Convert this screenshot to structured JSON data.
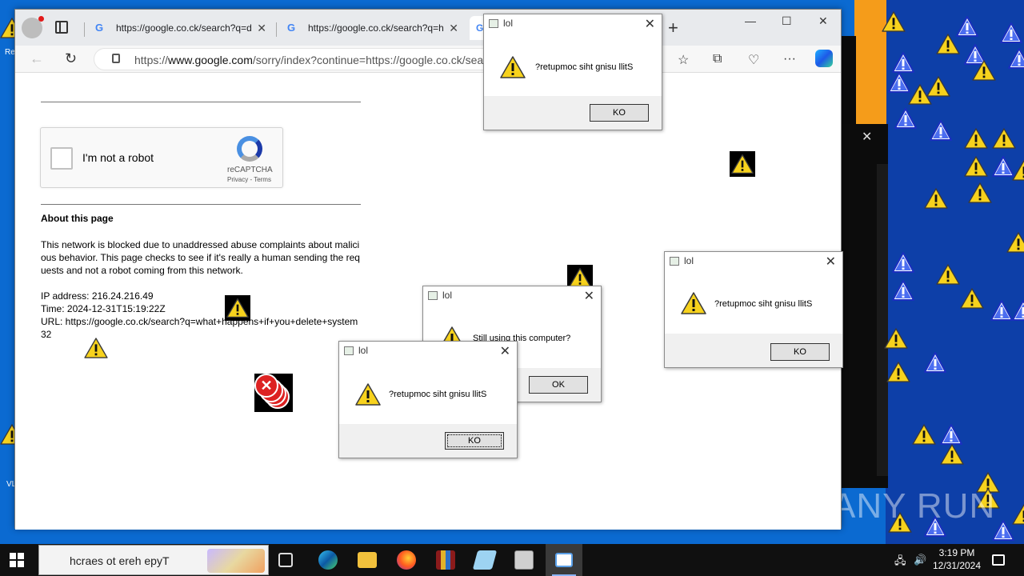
{
  "browser": {
    "tabs": [
      {
        "title": "https://google.co.ck/search?q=d"
      },
      {
        "title": "https://google.co.ck/search?q=h"
      },
      {
        "title": "G"
      }
    ],
    "new_tab": "+",
    "window_controls": {
      "minimize": "—",
      "maximize": "☐",
      "close": "✕"
    },
    "url_prefix": "https://",
    "url_host": "www.google.com",
    "url_path": "/sorry/index?continue=https://google.co.ck/sear"
  },
  "page": {
    "recaptcha": {
      "label": "I'm not a robot",
      "brand": "reCAPTCHA",
      "terms": "Privacy - Terms"
    },
    "about_title": "About this page",
    "about_text": "This network is blocked due to unaddressed abuse complaints about malicious behavior. This page checks to see if it's really a human sending the requests and not a robot coming from this network.",
    "ip_line": "IP address: 216.24.216.49",
    "time_line": "Time: 2024-12-31T15:19:22Z",
    "url_line": "URL: https://google.co.ck/search?q=what+happens+if+you+delete+system32"
  },
  "dialogs": [
    {
      "title": "lol",
      "message": "?retupmoc siht gnisu llitS",
      "button": "KO"
    },
    {
      "title": "lol",
      "message": "?retupmoc siht gnisu llitS",
      "button": "KO"
    },
    {
      "title": "lol",
      "message": "Still using this computer?",
      "button": "OK"
    },
    {
      "title": "lol",
      "message": "?retupmoc siht gnisu llitS",
      "button": "KO"
    }
  ],
  "taskbar": {
    "search_placeholder": "hcraes ot ereh epyT",
    "time": "3:19 PM",
    "date": "12/31/2024"
  },
  "desktop": {
    "labels": [
      "Re",
      "VL"
    ],
    "watermark": "ANY RUN"
  },
  "colors": {
    "desktop_blue": "#0b6ad1",
    "warning_yellow": "#f7d21d",
    "accent": "#8ab4f8"
  }
}
